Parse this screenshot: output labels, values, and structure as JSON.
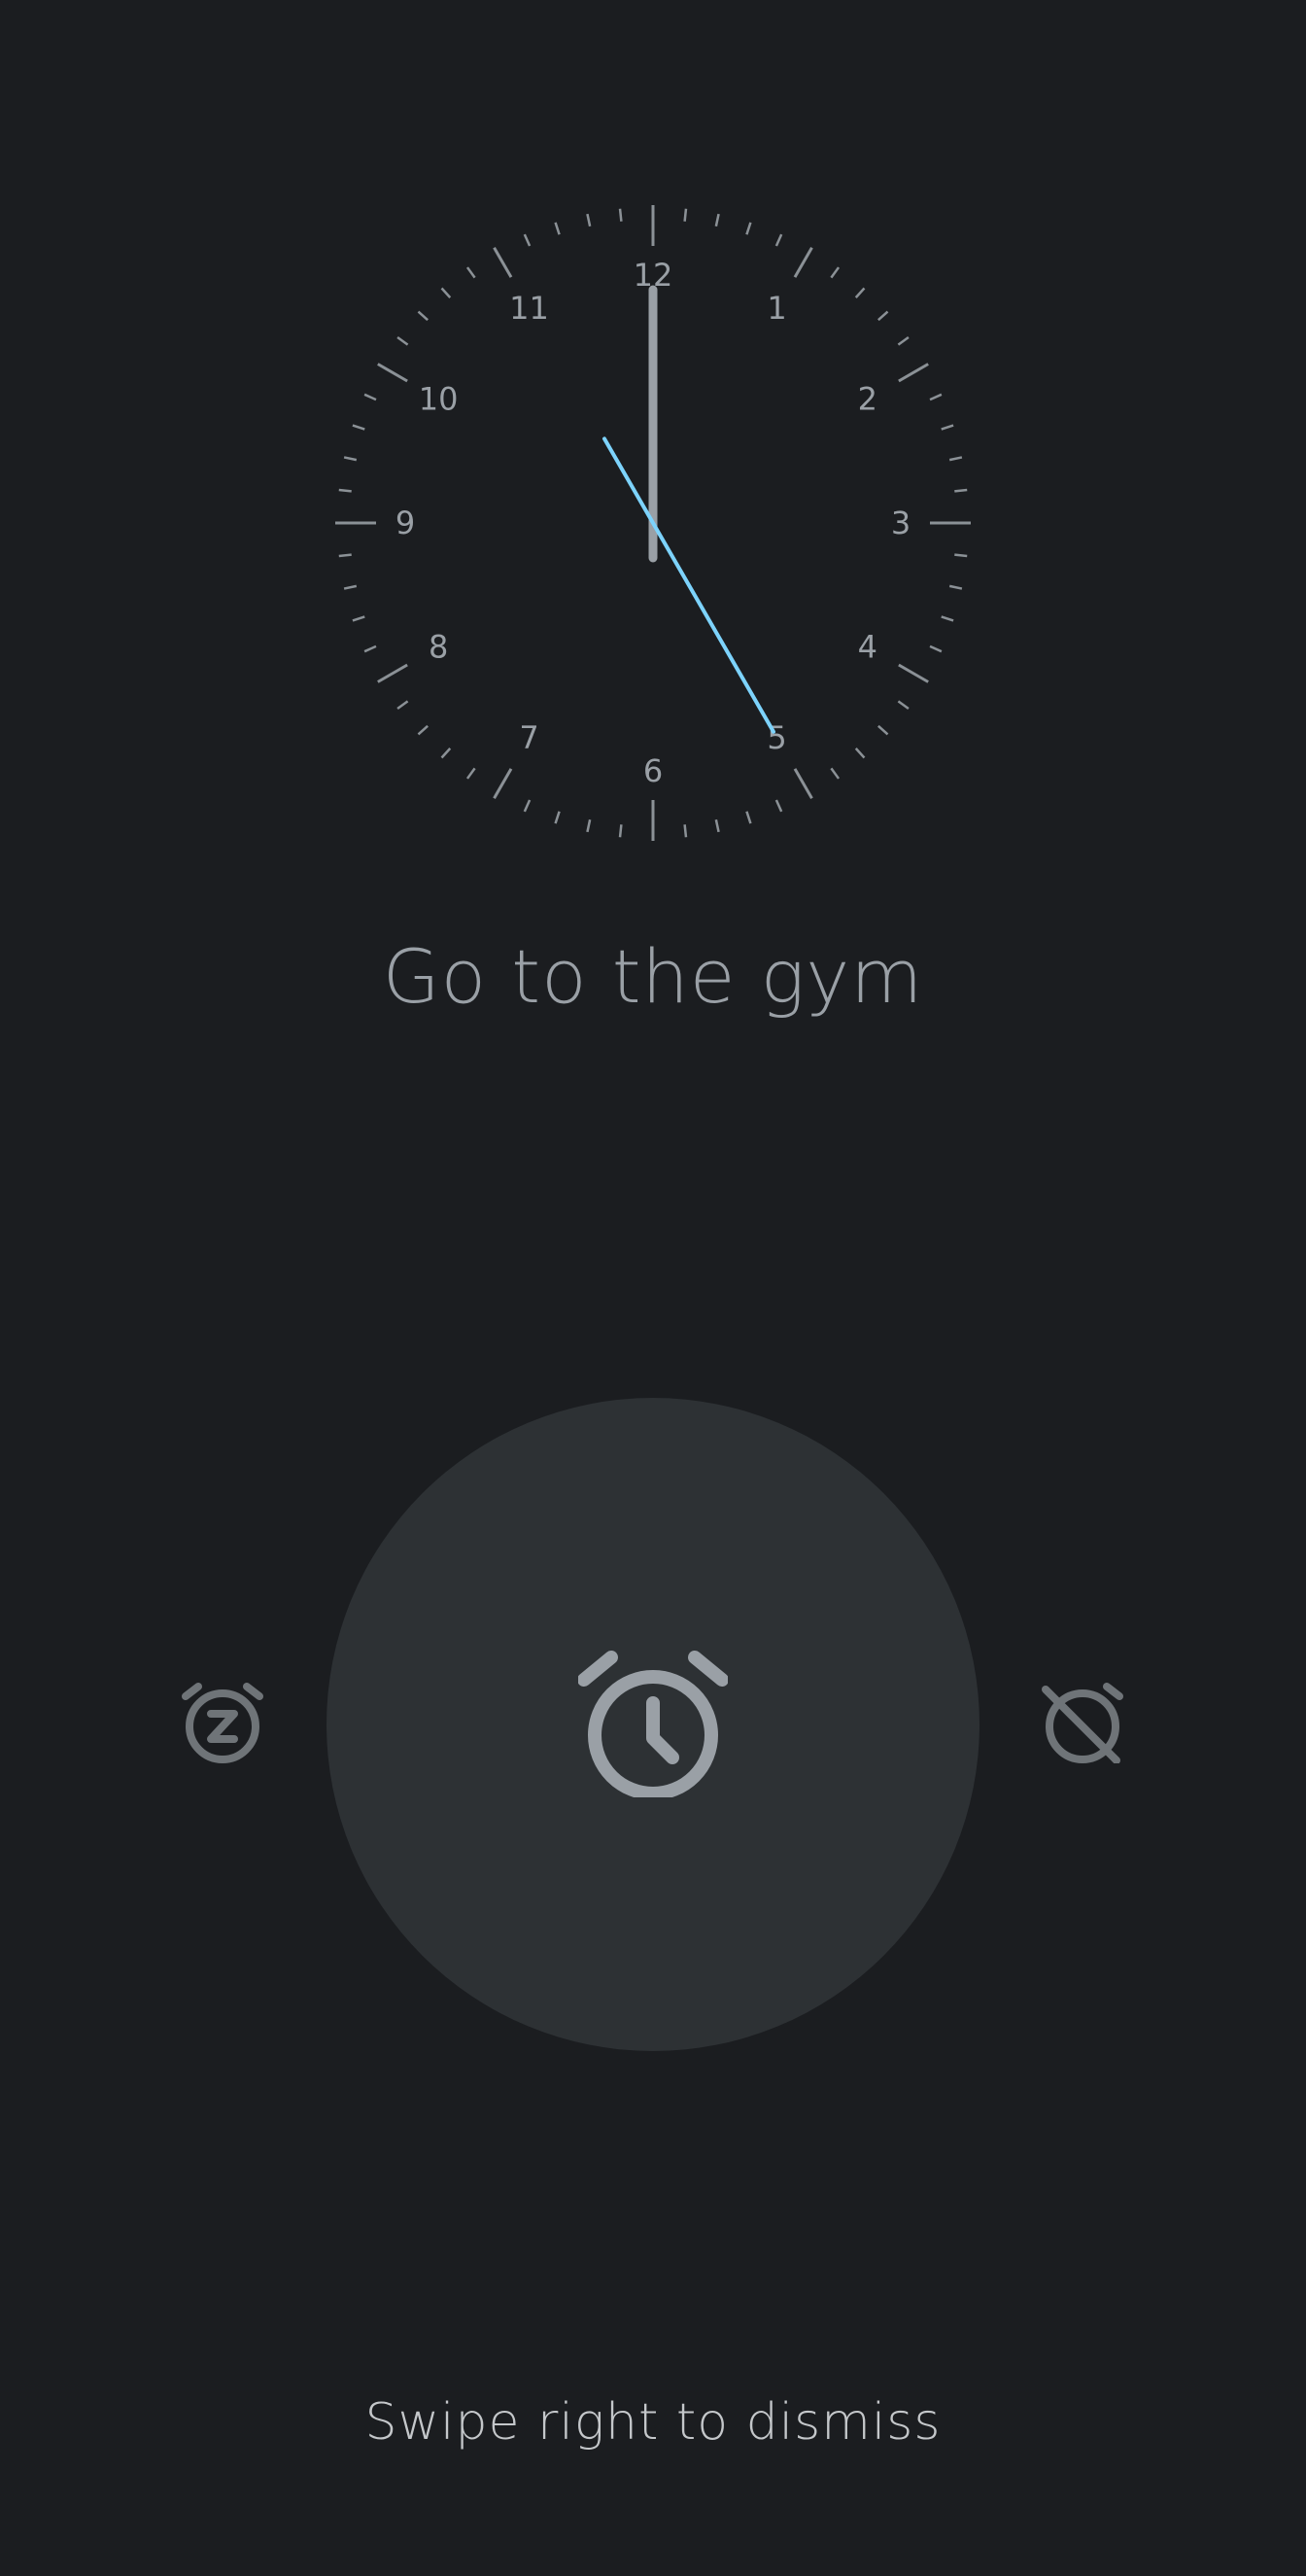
{
  "clock": {
    "numerals": [
      "12",
      "1",
      "2",
      "3",
      "4",
      "5",
      "6",
      "7",
      "8",
      "9",
      "10",
      "11"
    ],
    "hour": 12,
    "minute": 0,
    "second": 25
  },
  "alarm": {
    "label": "Go to the gym"
  },
  "actions": {
    "snooze_icon": "snooze-alarm-icon",
    "center_icon": "alarm-clock-icon",
    "dismiss_icon": "alarm-off-icon"
  },
  "hint": {
    "text": "Swipe right to dismiss"
  },
  "colors": {
    "background": "#1b1d20",
    "circle": "#2d3134",
    "text": "#9aa0a6",
    "ticks": "#8b9196",
    "hand": "#9aa0a6",
    "second_hand": "#7dd3fc",
    "side_icon": "#6f7478"
  }
}
